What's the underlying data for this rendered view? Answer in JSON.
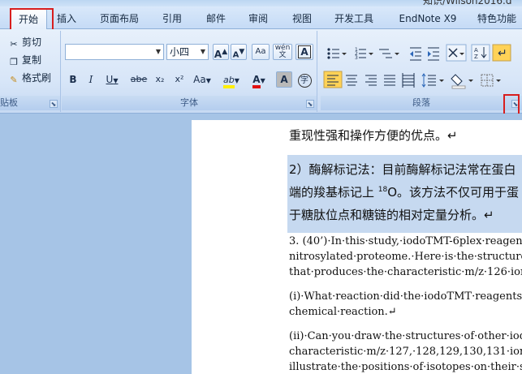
{
  "window": {
    "title_fragment": "知识/Wilson2016.d"
  },
  "tabs": [
    {
      "label": "开始",
      "active": true
    },
    {
      "label": "插入"
    },
    {
      "label": "页面布局"
    },
    {
      "label": "引用"
    },
    {
      "label": "邮件"
    },
    {
      "label": "审阅"
    },
    {
      "label": "视图"
    },
    {
      "label": "开发工具"
    },
    {
      "label": "EndNote X9"
    },
    {
      "label": "特色功能"
    }
  ],
  "clipboard": {
    "cut": "剪切",
    "copy": "复制",
    "format_painter": "格式刷",
    "group_label": "贴板"
  },
  "font": {
    "font_name_value": "",
    "font_size_value": "小四",
    "grow": "A",
    "shrink": "A",
    "clear_format": "Aa",
    "phonetic": "wén",
    "border_char": "A",
    "bold": "B",
    "italic": "I",
    "underline": "U",
    "strikethrough": "abe",
    "subscript": "x₂",
    "superscript": "x²",
    "change_case": "Aa",
    "highlight": "ab",
    "font_color": "A",
    "shading_char": "A",
    "enclose_char": "字",
    "group_label": "字体"
  },
  "paragraph": {
    "group_label": "段落"
  },
  "colors": {
    "highlight_yellow": "#ffee00",
    "font_red": "#e01010",
    "selection": "#c6d9f0",
    "annotation_red": "#d81e1e"
  },
  "document": {
    "line1": "重现性强和操作方便的优点。↵",
    "para2_line1": "2）酶解标记法：目前酶解标记法常在蛋白",
    "para2_line2_pre": "端的羧基标记上 ",
    "para2_line2_sup": "18",
    "para2_line2_post": "O。该方法不仅可用于蛋",
    "para2_line3": "于糖肽位点和糖链的相对定量分析。↵",
    "q3_line1": "3. (40’)·In·this·study,·iodoTMT-6plex·reagen",
    "q3_line2": "nitrosylated·proteome.·Here·is·the·structure·o",
    "q3_line3": "that·produces·the·characteristic·m/z·126·ion.·",
    "qi_line1": "(i)·What·reaction·did·the·iodoTMT·reagents·u",
    "qi_line2": "chemical·reaction.↵",
    "qii_line1": "(ii)·Can·you·draw·the·structures·of·other·iodo",
    "qii_line2": "characteristic·m/z·127,·128,129,130,131·ions",
    "qii_line3": "illustrate·the·positions·of·isotopes·on·their·str"
  }
}
